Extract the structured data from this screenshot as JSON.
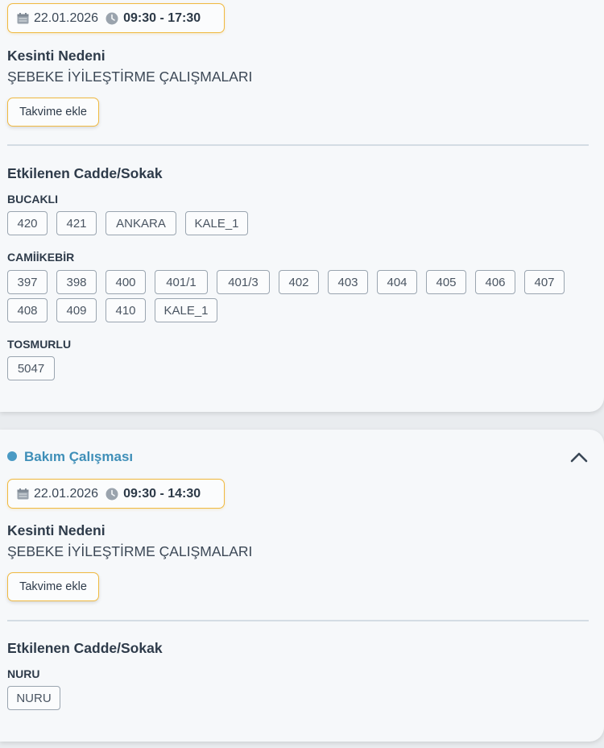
{
  "outages": [
    {
      "date": "22.01.2026",
      "time": "09:30 - 17:30",
      "reason_title": "Kesinti Nedeni",
      "reason": "ŞEBEKE İYİLEŞTİRME ÇALIŞMALARI",
      "calendar_button": "Takvime ekle",
      "streets_title": "Etkilenen Cadde/Sokak",
      "groups": [
        {
          "name": "BUCAKLI",
          "streets": [
            "420",
            "421",
            "ANKARA",
            "KALE_1"
          ]
        },
        {
          "name": "CAMİİKEBİR",
          "streets": [
            "397",
            "398",
            "400",
            "401/1",
            "401/3",
            "402",
            "403",
            "404",
            "405",
            "406",
            "407",
            "408",
            "409",
            "410",
            "KALE_1"
          ]
        },
        {
          "name": "TOSMURLU",
          "streets": [
            "5047"
          ]
        }
      ]
    },
    {
      "status": "Bakım Çalışması",
      "status_color": "#4a9ac4",
      "collapse_icon": "chevron-up-icon",
      "date": "22.01.2026",
      "time": "09:30 - 14:30",
      "reason_title": "Kesinti Nedeni",
      "reason": "ŞEBEKE İYİLEŞTİRME ÇALIŞMALARI",
      "calendar_button": "Takvime ekle",
      "streets_title": "Etkilenen Cadde/Sokak",
      "groups": [
        {
          "name": "NURU",
          "streets": [
            "NURU"
          ]
        }
      ]
    }
  ],
  "colors": {
    "accent_border": "#f0b940",
    "status_blue": "#4a9ac4"
  },
  "icons": {
    "date": "calendar-icon",
    "time": "clock-icon"
  }
}
